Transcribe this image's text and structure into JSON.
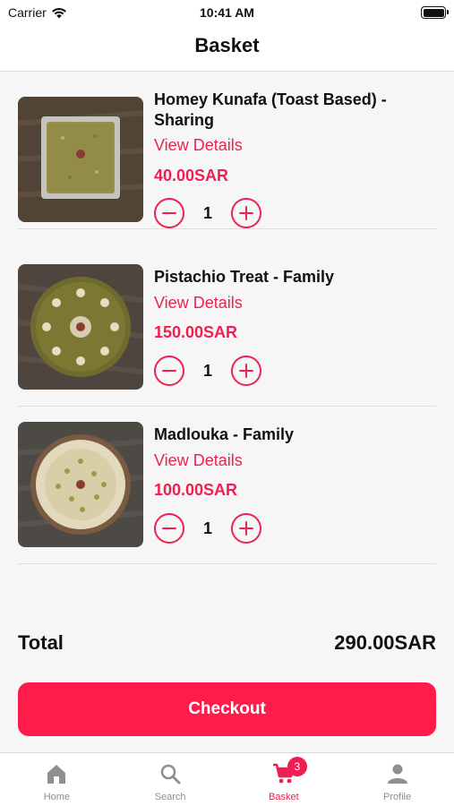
{
  "status_bar": {
    "carrier": "Carrier",
    "time": "10:41 AM"
  },
  "header": {
    "title": "Basket"
  },
  "items": [
    {
      "name": "Homey Kunafa (Toast Based) - Sharing",
      "details_label": "View Details",
      "price": "40.00SAR",
      "quantity": "1"
    },
    {
      "name": "Pistachio Treat - Family",
      "details_label": "View Details",
      "price": "150.00SAR",
      "quantity": "1"
    },
    {
      "name": "Madlouka - Family",
      "details_label": "View Details",
      "price": "100.00SAR",
      "quantity": "1"
    }
  ],
  "summary": {
    "total_label": "Total",
    "total_value": "290.00SAR"
  },
  "checkout_label": "Checkout",
  "tab_bar": {
    "tabs": [
      {
        "label": "Home",
        "icon": "home-icon"
      },
      {
        "label": "Search",
        "icon": "search-icon"
      },
      {
        "label": "Basket",
        "icon": "cart-icon",
        "active": true,
        "badge": "3"
      },
      {
        "label": "Profile",
        "icon": "person-icon"
      }
    ]
  },
  "colors": {
    "accent": "#ef2051",
    "button": "#ff1c4a",
    "inactive_tab": "#8e8e93"
  }
}
